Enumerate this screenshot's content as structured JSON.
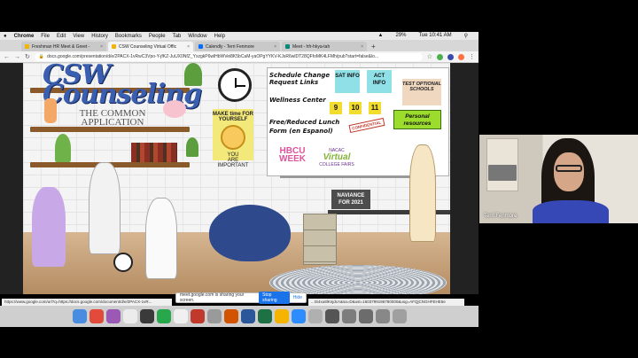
{
  "menubar": {
    "app": "Chrome",
    "items": [
      "File",
      "Edit",
      "View",
      "History",
      "Bookmarks",
      "People",
      "Tab",
      "Window",
      "Help"
    ],
    "battery": "29%",
    "clock": "Tue 10:41 AM"
  },
  "tabs": [
    {
      "label": "Freshman HR Meet & Greet -",
      "color": "#f2b400"
    },
    {
      "label": "CSW Counseling Virtual Offic",
      "color": "#f2b400"
    },
    {
      "label": "Calendly - Terri Fenmore",
      "color": "#006bff"
    },
    {
      "label": "Meet - hfr-hkya-tah",
      "color": "#00897b"
    }
  ],
  "active_tab": 1,
  "address": {
    "url": "docs.google.com/presentation/d/e/2PACX-1vRwC3Vpo-Y-jfKZ-JuUX0NfZ_YxzgkP6wlHbWVei8K5bCaM-yaOPgYYKV-KJsR6wlDT28QFfoMK4LFMh/pub?start=false&lo..."
  },
  "slide": {
    "logo_line1": "CSW",
    "logo_line2": "Counseling",
    "common_app": "THE COMMON APPLICATION",
    "poster_title": "MAKE time FOR YOURSELF",
    "poster_you": "YOU",
    "poster_sub": "ARE IMPORTANT",
    "schedule_change": "Schedule Change Request Links",
    "wellness": "Wellness Center",
    "lunch": "Free/Reduced Lunch Form (en Espanol)",
    "sat": "SAT INFO",
    "act": "ACT INFO",
    "test_optional": "TEST OPTIONAL SCHOOLS",
    "personal": "Personal resources",
    "confidential": "CONFIDENTIAL",
    "grade_tiles": [
      "9",
      "10",
      "11"
    ],
    "hbcu_line1": "HBCU",
    "hbcu_line2": "WEEK",
    "nacac_top": "NACAC",
    "nacac_main": "Virtual",
    "nacac_sub": "COLLEGE FAIRS",
    "naviance_line1": "NAVIANCE",
    "naviance_line2": "FOR 2021"
  },
  "share_bar": {
    "message": "meet.google.com is sharing your screen.",
    "stop": "Stop sharing",
    "hide": "Hide"
  },
  "status_url_left": "https://www.google.com/url?q=https://docs.google.com/document/d/e/2PACX-1vR...",
  "status_url_right": "...IS4xu8lKnjdcA&sa=D&ust=1603799196780000&usg=AFQjCNGHFEHE5e",
  "dock_colors": [
    "#4a8de0",
    "#e24a3b",
    "#9b59b6",
    "#ececec",
    "#3a3a3a",
    "#27a84a",
    "#f0f0f0",
    "#c0392b",
    "#9a9a9a",
    "#d35400",
    "#2b579a",
    "#1e7145",
    "#f4b400",
    "#2d8cff",
    "#b0b0b0",
    "#555555",
    "#7d7d7d",
    "#6c6c6c",
    "#888888",
    "#a0a0a0"
  ],
  "video": {
    "name": "Terri Fenmore"
  }
}
